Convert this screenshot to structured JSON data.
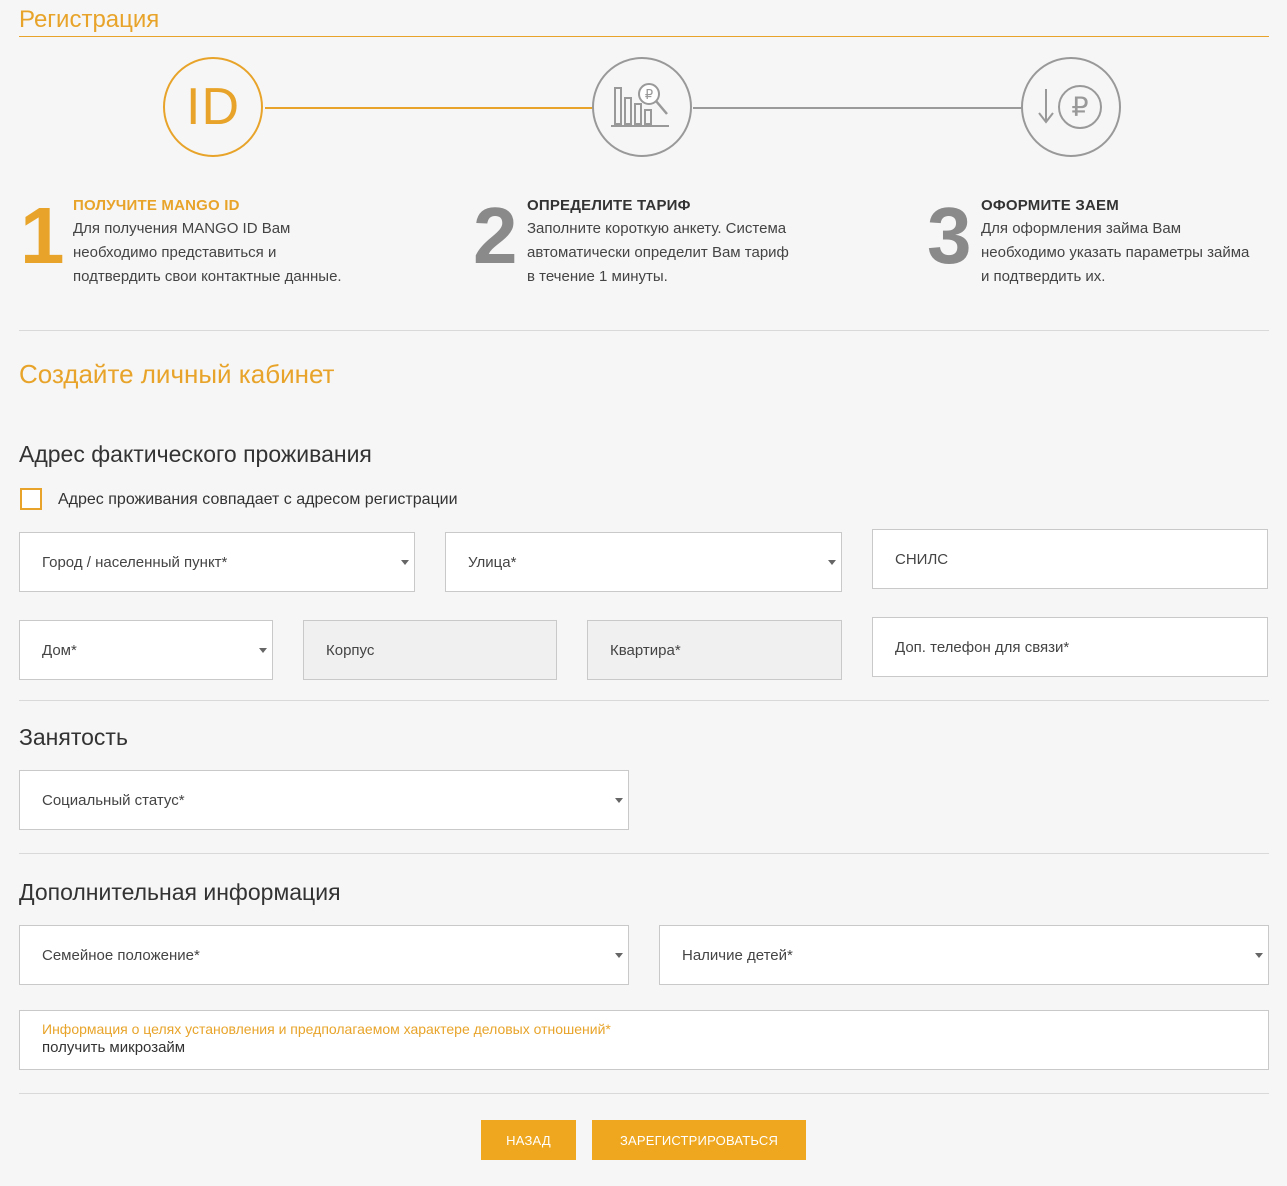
{
  "page": {
    "title": "Регистрация"
  },
  "steps": [
    {
      "number": "1",
      "icon": "id-icon",
      "icon_text": "ID",
      "title": "ПОЛУЧИТЕ MANGO ID",
      "lines": [
        "Для получения MANGO ID Вам",
        "необходимо представиться и",
        "подтвердить свои контактные данные."
      ],
      "active": true
    },
    {
      "number": "2",
      "icon": "tariff-chart-icon",
      "title": "ОПРЕДЕЛИТЕ ТАРИФ",
      "lines": [
        "Заполните короткую анкету. Система",
        "автоматически определит Вам тариф",
        "в течение 1 минуты."
      ],
      "active": false
    },
    {
      "number": "3",
      "icon": "ruble-loan-icon",
      "title": "ОФОРМИТЕ ЗАЕМ",
      "lines": [
        "Для оформления займа Вам",
        "необходимо указать параметры займа",
        "и подтвердить их."
      ],
      "active": false
    }
  ],
  "form": {
    "title": "Создайте личный кабинет",
    "address": {
      "title": "Адрес фактического проживания",
      "same_as_registration": "Адрес проживания совпадает с адресом регистрации",
      "city": "Город / населенный пункт*",
      "street": "Улица*",
      "snils": "СНИЛС",
      "house": "Дом*",
      "building": "Корпус",
      "apartment": "Квартира*",
      "extra_phone": "Доп. телефон для связи*"
    },
    "employment": {
      "title": "Занятость",
      "social_status": "Социальный статус*"
    },
    "additional": {
      "title": "Дополнительная информация",
      "marital_status": "Семейное положение*",
      "children": "Наличие детей*",
      "purpose_label": "Информация о целях установления и предполагаемом характере деловых отношений*",
      "purpose_value": "получить микрозайм"
    }
  },
  "buttons": {
    "back": "НАЗАД",
    "register": "ЗАРЕГИСТРИРОВАТЬСЯ"
  },
  "colors": {
    "accent": "#e8a42a",
    "button": "#eea71e",
    "inactive": "#999999"
  }
}
